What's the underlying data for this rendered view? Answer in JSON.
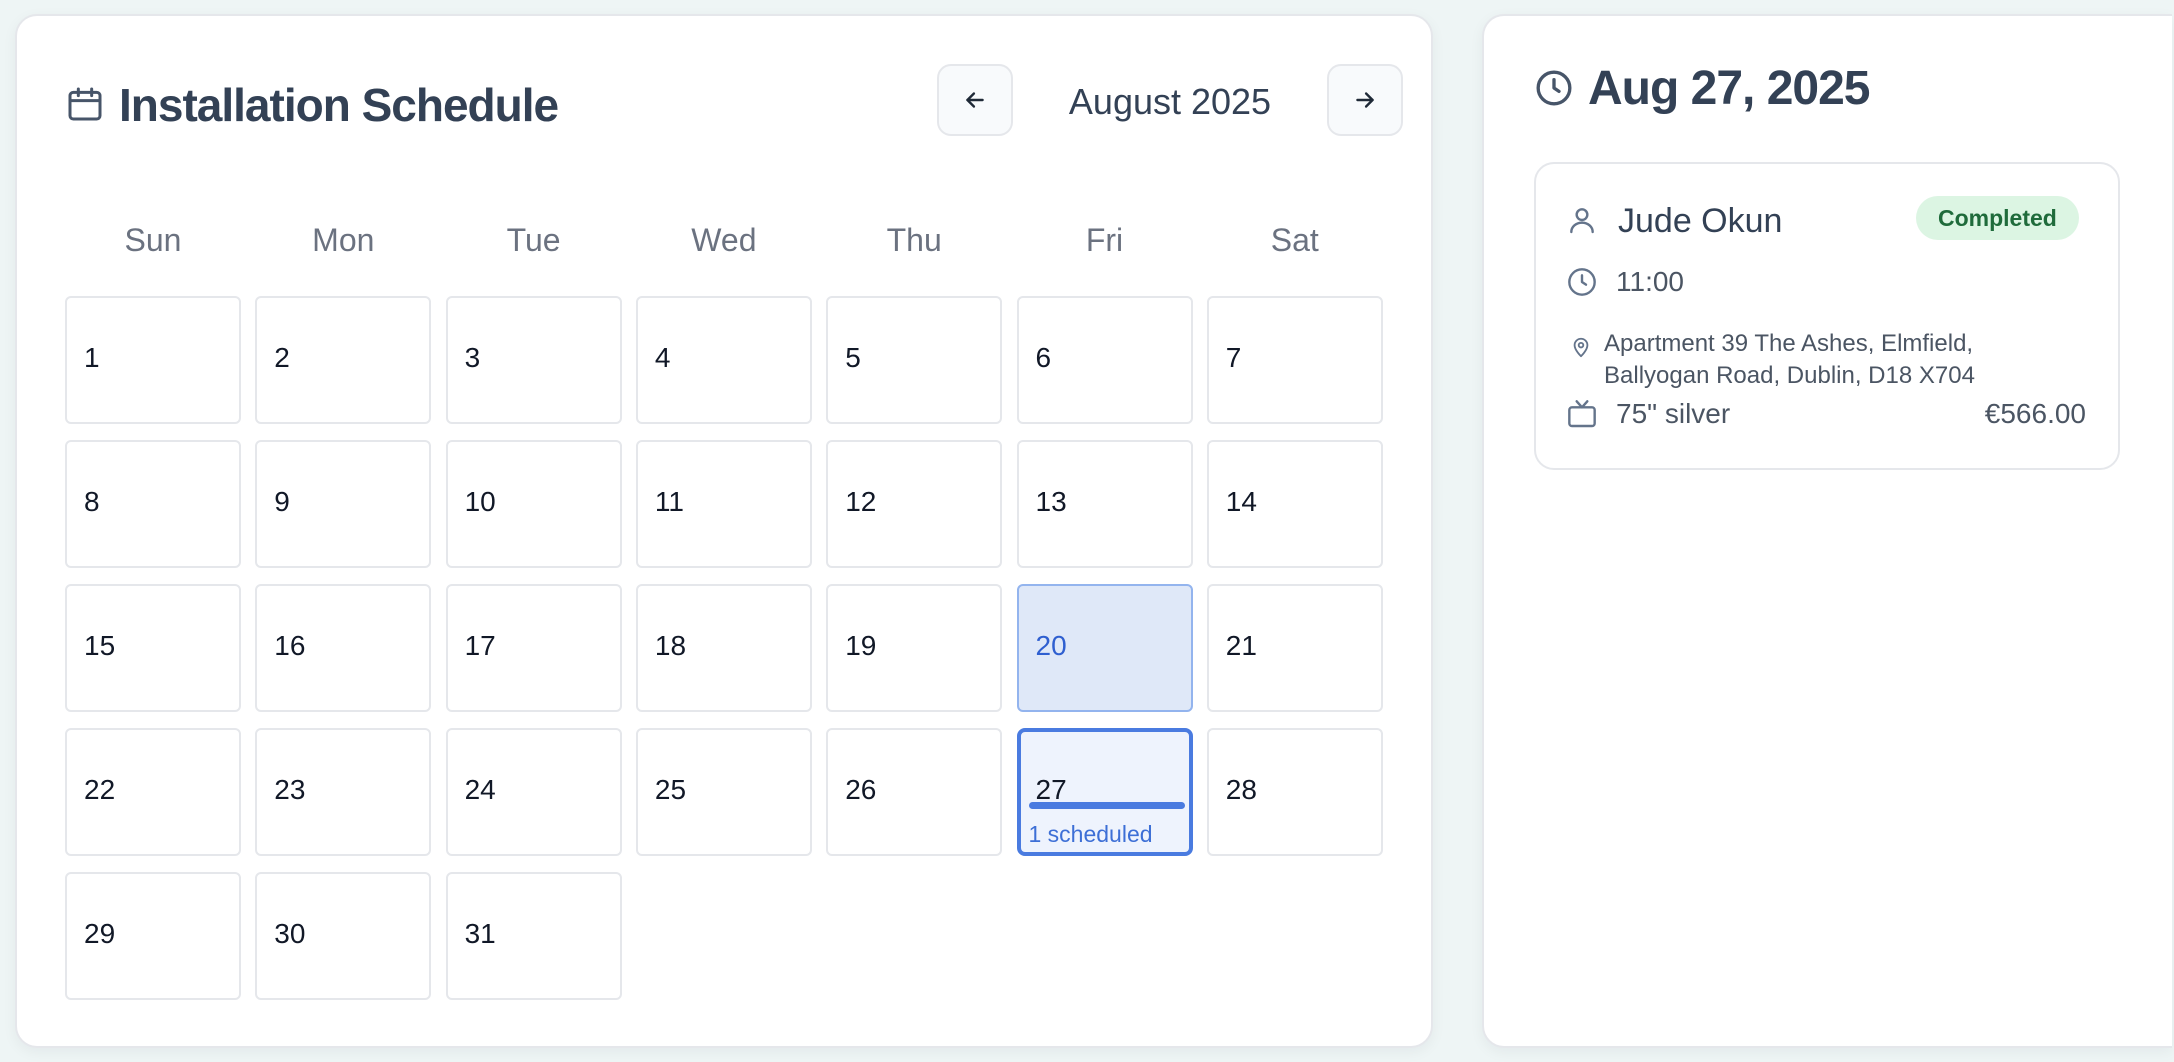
{
  "calendar": {
    "title": "Installation Schedule",
    "month_label": "August 2025",
    "weekdays": [
      "Sun",
      "Mon",
      "Tue",
      "Wed",
      "Thu",
      "Fri",
      "Sat"
    ],
    "days": [
      "1",
      "2",
      "3",
      "4",
      "5",
      "6",
      "7",
      "8",
      "9",
      "10",
      "11",
      "12",
      "13",
      "14",
      "15",
      "16",
      "17",
      "18",
      "19",
      "20",
      "21",
      "22",
      "23",
      "24",
      "25",
      "26",
      "27",
      "28",
      "29",
      "30",
      "31"
    ],
    "today_day": "20",
    "selected_day": "27",
    "selected_scheduled_label": "1 scheduled"
  },
  "detail": {
    "date_heading": "Aug 27, 2025",
    "appointment": {
      "client_name": "Jude Okun",
      "status": "Completed",
      "time": "11:00",
      "address_line1": "Apartment 39 The Ashes, Elmfield,",
      "address_line2": "Ballyogan Road, Dublin, D18 X704",
      "product": "75\" silver",
      "price": "€566.00"
    }
  },
  "icons": {
    "title": "calendar-icon",
    "prev": "arrow-left-icon",
    "next": "arrow-right-icon",
    "date": "clock-icon",
    "client": "user-icon",
    "time": "clock-icon",
    "address": "map-pin-icon",
    "product": "tv-icon"
  },
  "colors": {
    "accent": "#4a7be0",
    "today_bg": "#dfe8f8",
    "status_bg": "#dcf5e3",
    "status_text": "#1f6b3b"
  }
}
